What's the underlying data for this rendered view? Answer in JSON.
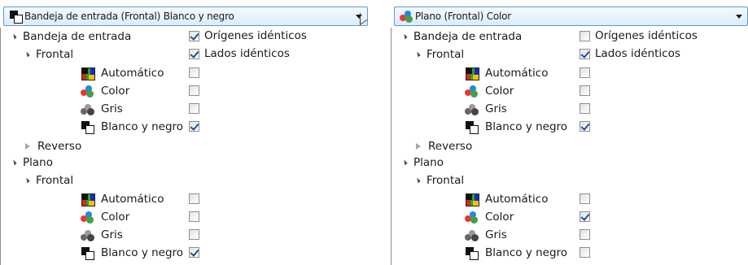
{
  "panels": [
    {
      "header": {
        "label": "Bandeja de entrada (Frontal) Blanco y negro",
        "icon": "black-white-icon"
      },
      "tree": {
        "bandeja": {
          "label": "Bandeja de entrada",
          "origenes_label": "Orígenes idénticos",
          "origenes_checked": true
        },
        "frontal": {
          "label": "Frontal",
          "lados_label": "Lados idénticos",
          "lados_checked": true
        },
        "frontal_modes": [
          {
            "label": "Automático",
            "icon": "auto-icon",
            "checked": false
          },
          {
            "label": "Color",
            "icon": "color-icon",
            "checked": false
          },
          {
            "label": "Gris",
            "icon": "gray-icon",
            "checked": false
          },
          {
            "label": "Blanco y negro",
            "icon": "black-white-icon",
            "checked": true
          }
        ],
        "reverso": {
          "label": "Reverso"
        },
        "plano": {
          "label": "Plano"
        },
        "plano_frontal": {
          "label": "Frontal"
        },
        "plano_modes": [
          {
            "label": "Automático",
            "icon": "auto-icon",
            "checked": false
          },
          {
            "label": "Color",
            "icon": "color-icon",
            "checked": false
          },
          {
            "label": "Gris",
            "icon": "gray-icon",
            "checked": false
          },
          {
            "label": "Blanco y negro",
            "icon": "black-white-icon",
            "checked": true
          }
        ]
      }
    },
    {
      "header": {
        "label": "Plano (Frontal) Color",
        "icon": "color-icon"
      },
      "tree": {
        "bandeja": {
          "label": "Bandeja de entrada",
          "origenes_label": "Orígenes idénticos",
          "origenes_checked": false
        },
        "frontal": {
          "label": "Frontal",
          "lados_label": "Lados idénticos",
          "lados_checked": true
        },
        "frontal_modes": [
          {
            "label": "Automático",
            "icon": "auto-icon",
            "checked": false
          },
          {
            "label": "Color",
            "icon": "color-icon",
            "checked": false
          },
          {
            "label": "Gris",
            "icon": "gray-icon",
            "checked": false
          },
          {
            "label": "Blanco y negro",
            "icon": "black-white-icon",
            "checked": true
          }
        ],
        "reverso": {
          "label": "Reverso"
        },
        "plano": {
          "label": "Plano"
        },
        "plano_frontal": {
          "label": "Frontal"
        },
        "plano_modes": [
          {
            "label": "Automático",
            "icon": "auto-icon",
            "checked": false
          },
          {
            "label": "Color",
            "icon": "color-icon",
            "checked": true
          },
          {
            "label": "Gris",
            "icon": "gray-icon",
            "checked": false
          },
          {
            "label": "Blanco y negro",
            "icon": "black-white-icon",
            "checked": false
          }
        ]
      }
    }
  ],
  "colors": {
    "combo_border": "#5b9bd5",
    "combo_bg_top": "#f5fafe",
    "combo_bg_bottom": "#dcebfb",
    "check_color": "#1f4c9c",
    "tree_line": "#8c8c8c"
  }
}
